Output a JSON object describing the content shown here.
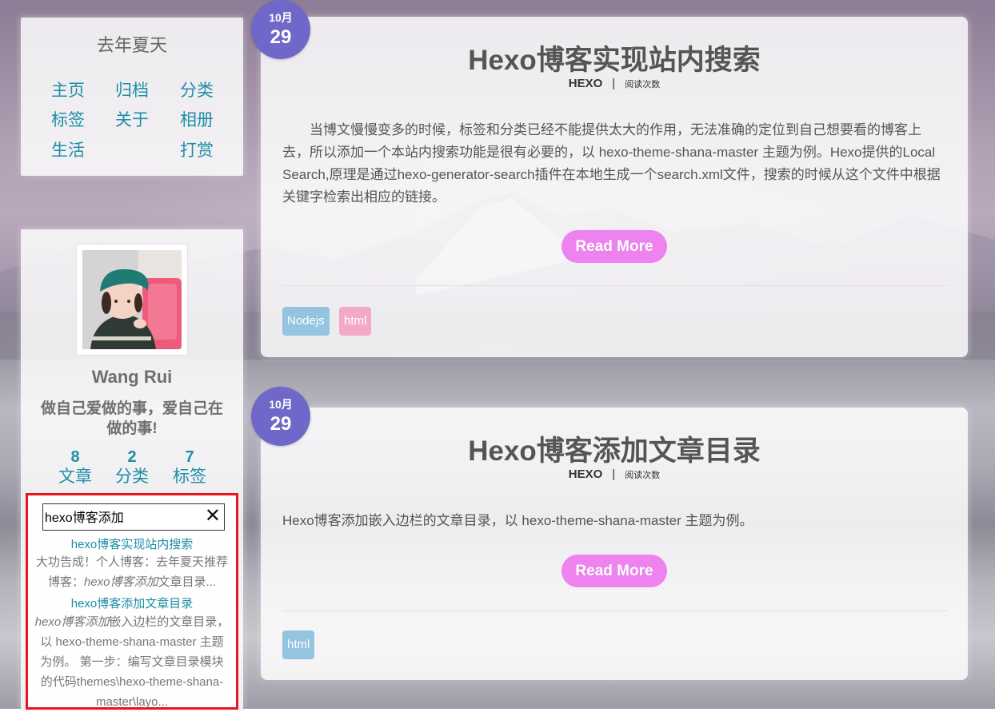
{
  "colors": {
    "link": "#1e8ea7",
    "read_more": "#ee82ee",
    "date_badge": "#6f68c9",
    "tag_blue": "#94c4df",
    "tag_pink": "#f5a9c9",
    "search_highlight_border": "#e8141e"
  },
  "sidebar": {
    "site_name": "去年夏天",
    "nav": {
      "home": "主页",
      "archive": "归档",
      "categories": "分类",
      "tags": "标签",
      "about": "关于",
      "album": "相册",
      "life": "生活",
      "reward": "打赏"
    },
    "profile": {
      "author": "Wang Rui",
      "motto": "做自己爱做的事，爱自己在做的事!",
      "stats": [
        {
          "count": "8",
          "label": "文章"
        },
        {
          "count": "2",
          "label": "分类"
        },
        {
          "count": "7",
          "label": "标签"
        }
      ]
    },
    "search": {
      "value": "hexo博客添加",
      "clear_icon": "✕",
      "results": [
        {
          "title": "hexo博客实现站内搜索",
          "snippet_before": "大功告成！个人博客：去年夏天推荐博客：",
          "snippet_match": "hexo博客添加",
          "snippet_after": "文章目录..."
        },
        {
          "title": "hexo博客添加文章目录",
          "snippet_before": "",
          "snippet_match": "hexo博客添加",
          "snippet_after": "嵌入边栏的文章目录，以 hexo-theme-shana-master 主题为例。 第一步：编写文章目录模块的代码themes\\hexo-theme-shana-master\\layo..."
        }
      ]
    }
  },
  "posts": [
    {
      "date_month": "10月",
      "date_day": "29",
      "title": "Hexo博客实现站内搜索",
      "category": "HEXO",
      "separator": "|",
      "views_label": "阅读次数",
      "excerpt": "当博文慢慢变多的时候，标签和分类已经不能提供太大的作用，无法准确的定位到自己想要看的博客上去，所以添加一个本站内搜索功能是很有必要的，以 hexo-theme-shana-master 主题为例。Hexo提供的Local Search,原理是通过hexo-generator-search插件在本地生成一个search.xml文件，搜索的时候从这个文件中根据关键字检索出相应的链接。",
      "read_more": "Read More",
      "tags": [
        "Nodejs",
        "html"
      ]
    },
    {
      "date_month": "10月",
      "date_day": "29",
      "title": "Hexo博客添加文章目录",
      "category": "HEXO",
      "separator": "|",
      "views_label": "阅读次数",
      "excerpt": "Hexo博客添加嵌入边栏的文章目录，以 hexo-theme-shana-master 主题为例。",
      "read_more": "Read More",
      "tags": [
        "html"
      ]
    }
  ]
}
